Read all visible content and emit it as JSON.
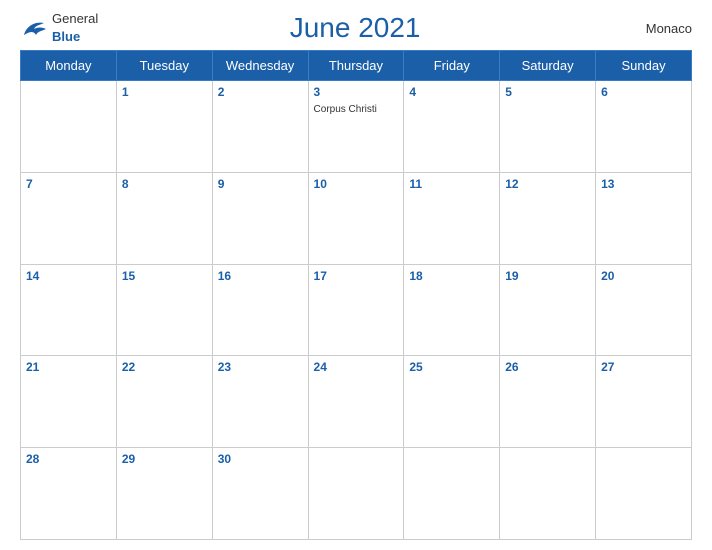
{
  "header": {
    "logo_general": "General",
    "logo_blue": "Blue",
    "title": "June 2021",
    "country": "Monaco"
  },
  "weekdays": [
    "Monday",
    "Tuesday",
    "Wednesday",
    "Thursday",
    "Friday",
    "Saturday",
    "Sunday"
  ],
  "weeks": [
    [
      {
        "day": "",
        "event": ""
      },
      {
        "day": "1",
        "event": ""
      },
      {
        "day": "2",
        "event": ""
      },
      {
        "day": "3",
        "event": "Corpus Christi"
      },
      {
        "day": "4",
        "event": ""
      },
      {
        "day": "5",
        "event": ""
      },
      {
        "day": "6",
        "event": ""
      }
    ],
    [
      {
        "day": "7",
        "event": ""
      },
      {
        "day": "8",
        "event": ""
      },
      {
        "day": "9",
        "event": ""
      },
      {
        "day": "10",
        "event": ""
      },
      {
        "day": "11",
        "event": ""
      },
      {
        "day": "12",
        "event": ""
      },
      {
        "day": "13",
        "event": ""
      }
    ],
    [
      {
        "day": "14",
        "event": ""
      },
      {
        "day": "15",
        "event": ""
      },
      {
        "day": "16",
        "event": ""
      },
      {
        "day": "17",
        "event": ""
      },
      {
        "day": "18",
        "event": ""
      },
      {
        "day": "19",
        "event": ""
      },
      {
        "day": "20",
        "event": ""
      }
    ],
    [
      {
        "day": "21",
        "event": ""
      },
      {
        "day": "22",
        "event": ""
      },
      {
        "day": "23",
        "event": ""
      },
      {
        "day": "24",
        "event": ""
      },
      {
        "day": "25",
        "event": ""
      },
      {
        "day": "26",
        "event": ""
      },
      {
        "day": "27",
        "event": ""
      }
    ],
    [
      {
        "day": "28",
        "event": ""
      },
      {
        "day": "29",
        "event": ""
      },
      {
        "day": "30",
        "event": ""
      },
      {
        "day": "",
        "event": ""
      },
      {
        "day": "",
        "event": ""
      },
      {
        "day": "",
        "event": ""
      },
      {
        "day": "",
        "event": ""
      }
    ]
  ]
}
